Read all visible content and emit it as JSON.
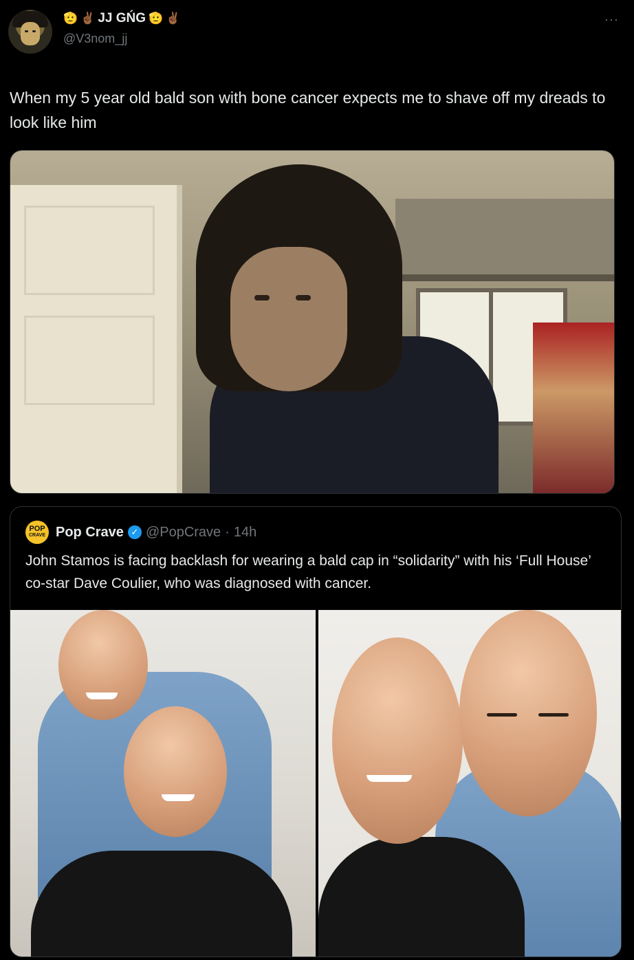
{
  "tweet": {
    "display_name": "JJ GŃG",
    "name_emojis_before": [
      "🫡",
      "✌🏾"
    ],
    "name_emojis_after": [
      "🫡",
      "✌🏾"
    ],
    "handle": "@V3nom_jj",
    "more_icon": "···",
    "text": "When my 5 year old bald son with bone cancer expects me to shave off my dreads to look like him"
  },
  "quoted_tweet": {
    "logo_line1": "POP",
    "logo_line2": "CRAVE",
    "display_name": "Pop Crave",
    "verified_icon": "✓",
    "handle": "@PopCrave",
    "separator": "·",
    "time": "14h",
    "text": "John Stamos is facing backlash for wearing a bald cap in “solidarity” with his ‘Full House’ co-star Dave Coulier, who was diagnosed with cancer."
  },
  "colors": {
    "background": "#000000",
    "text_primary": "#e7e9ea",
    "text_secondary": "#71767b",
    "border": "#2f3336",
    "verified": "#1d9bf0",
    "pop_crave_logo": "#f4c22a"
  },
  "icons": {
    "avatar": "user-avatar",
    "more": "more-options-icon",
    "verified": "verified-badge-icon"
  }
}
